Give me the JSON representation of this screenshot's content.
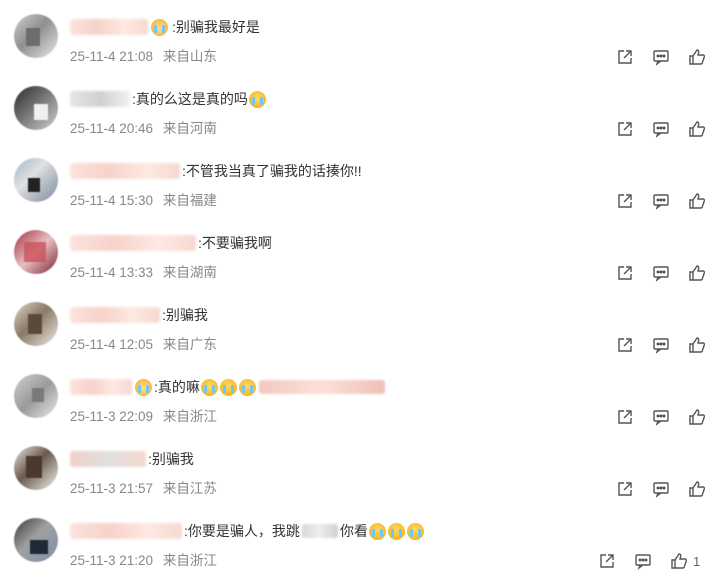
{
  "comments": [
    {
      "text": ":别骗我最好是",
      "time": "25-11-4 21:08",
      "location": "来自山东",
      "likes": ""
    },
    {
      "text": ":真的么这是真的吗",
      "time": "25-11-4 20:46",
      "location": "来自河南",
      "likes": ""
    },
    {
      "text": ":不管我当真了骗我的话揍你!!",
      "time": "25-11-4 15:30",
      "location": "来自福建",
      "likes": ""
    },
    {
      "text": ":不要骗我啊",
      "time": "25-11-4 13:33",
      "location": "来自湖南",
      "likes": ""
    },
    {
      "text": ":别骗我",
      "time": "25-11-4 12:05",
      "location": "来自广东",
      "likes": ""
    },
    {
      "text": ":真的嘛",
      "time": "25-11-3 22:09",
      "location": "来自浙江",
      "likes": ""
    },
    {
      "text": ":别骗我",
      "time": "25-11-3 21:57",
      "location": "来自江苏",
      "likes": ""
    },
    {
      "text_a": ":你要是骗人，我跳",
      "text_b": "你看",
      "time": "25-11-3 21:20",
      "location": "来自浙江",
      "likes": "1"
    }
  ],
  "icons": {
    "share": "share-icon",
    "comment": "comment-icon",
    "like": "thumbs-up-icon"
  },
  "colors": {
    "text": "#333333",
    "meta": "#888888",
    "icon": "#555555"
  }
}
